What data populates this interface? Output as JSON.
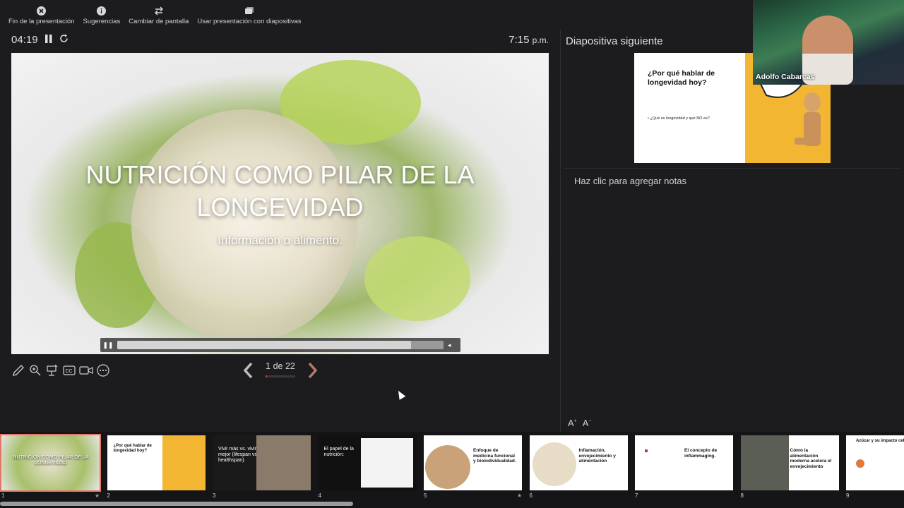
{
  "toolbar": {
    "items": [
      {
        "label": "Fin de la presentación",
        "icon": "close-circle-icon"
      },
      {
        "label": "Sugerencias",
        "icon": "info-icon"
      },
      {
        "label": "Cambiar de pantalla",
        "icon": "swap-icon"
      },
      {
        "label": "Usar presentación con diapositivas",
        "icon": "slideshow-icon"
      }
    ]
  },
  "timer": {
    "elapsed": "04:19",
    "clock": "7:15",
    "clock_suffix": "p.m."
  },
  "slide": {
    "title": "NUTRICIÓN COMO PILAR DE LA LONGEVIDAD",
    "subtitle": "Información o alimento.",
    "media_progress": 0.9
  },
  "navigation": {
    "counter": "1 de 22",
    "progress": 0.05
  },
  "next": {
    "label": "Diapositiva siguiente",
    "title": "¿Por qué hablar de longevidad hoy?",
    "bullet": "•  ¿Qué es longevidad y qué NO es?"
  },
  "notes": {
    "placeholder": "Haz clic para agregar notas"
  },
  "webcam": {
    "name": "Adolfo Cabarcas"
  },
  "thumbnails": [
    {
      "num": "1",
      "text": "NUTRICIÓN COMO PILAR DE LA LONGEVIDAD",
      "starred": true,
      "bg": "#b8c48a"
    },
    {
      "num": "2",
      "text": "¿Por qué hablar de longevidad hoy?",
      "starred": false,
      "bg": "#ffffff"
    },
    {
      "num": "3",
      "text": "Vivir más vs. vivir mejor (lifespan vs healthspan).",
      "starred": false,
      "bg": "#1a1a1a"
    },
    {
      "num": "4",
      "text": "El papel de la nutrición:",
      "starred": false,
      "bg": "#111111"
    },
    {
      "num": "5",
      "text": "Enfoque de medicina funcional y bioindividualidad.",
      "starred": true,
      "bg": "#ffffff"
    },
    {
      "num": "6",
      "text": "Inflamación, envejecimiento y alimentación",
      "starred": false,
      "bg": "#ffffff"
    },
    {
      "num": "7",
      "text": "El concepto de inflammaging.",
      "starred": false,
      "bg": "#ffffff"
    },
    {
      "num": "8",
      "text": "Cómo la alimentación moderna acelera el envejecimiento",
      "starred": false,
      "bg": "#ffffff"
    },
    {
      "num": "9",
      "text": "Azúcar y su impacto celular.",
      "starred": false,
      "bg": "#ffffff"
    }
  ]
}
